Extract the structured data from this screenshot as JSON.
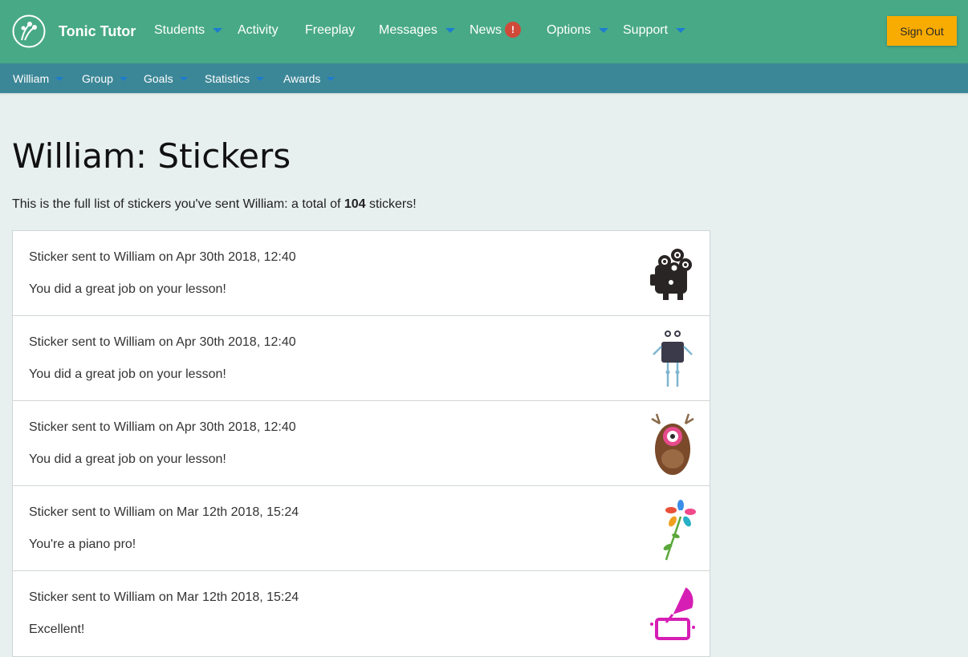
{
  "header": {
    "brand": "Tonic Tutor",
    "nav": [
      {
        "label": "Students",
        "dropdown": true
      },
      {
        "label": "Activity",
        "dropdown": false
      },
      {
        "label": "Freeplay",
        "dropdown": false
      },
      {
        "label": "Messages",
        "dropdown": true
      },
      {
        "label": "News",
        "dropdown": false,
        "badge": "!"
      },
      {
        "label": "Options",
        "dropdown": true
      },
      {
        "label": "Support",
        "dropdown": true
      }
    ],
    "sign_out": "Sign Out"
  },
  "subnav": [
    {
      "label": "William"
    },
    {
      "label": "Group"
    },
    {
      "label": "Goals"
    },
    {
      "label": "Statistics"
    },
    {
      "label": "Awards"
    }
  ],
  "page": {
    "title": "William: Stickers",
    "intro_before": "This is the full list of stickers you've sent William: a total of ",
    "intro_count": "104",
    "intro_after": " stickers!"
  },
  "stickers": [
    {
      "meta": "Sticker sent to William on Apr 30th 2018, 12:40",
      "message": "You did a great job on your lesson!",
      "icon": "camera-monster-icon"
    },
    {
      "meta": "Sticker sent to William on Apr 30th 2018, 12:40",
      "message": "You did a great job on your lesson!",
      "icon": "robot-monster-icon"
    },
    {
      "meta": "Sticker sent to William on Apr 30th 2018, 12:40",
      "message": "You did a great job on your lesson!",
      "icon": "antler-monster-icon"
    },
    {
      "meta": "Sticker sent to William on Mar 12th 2018, 15:24",
      "message": "You're a piano pro!",
      "icon": "flower-icon"
    },
    {
      "meta": "Sticker sent to William on Mar 12th 2018, 15:24",
      "message": "Excellent!",
      "icon": "gramophone-icon"
    }
  ],
  "colors": {
    "topbar": "#48a987",
    "subbar": "#3c8797",
    "signout": "#f8ab00",
    "badge": "#d04a39",
    "caret": "#1d7bd0"
  }
}
